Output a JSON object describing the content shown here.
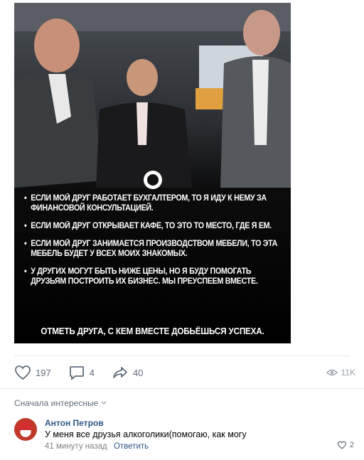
{
  "post": {
    "caption_bullets": [
      "ЕСЛИ МОЙ ДРУГ РАБОТАЕТ БУХГАЛТЕРОМ, ТО Я ИДУ К НЕМУ ЗА ФИНАНСОВОЙ КОНСУЛЬТАЦИЕЙ.",
      "ЕСЛИ МОЙ ДРУГ ОТКРЫВАЕТ КАФЕ, ТО ЭТО ТО МЕСТО, ГДЕ Я ЕМ.",
      "ЕСЛИ МОЙ ДРУГ ЗАНИМАЕТСЯ ПРОИЗВОДСТВОМ МЕБЕЛИ, ТО ЭТА МЕБЕЛЬ БУДЕТ У ВСЕХ МОИХ ЗНАКОМЫХ.",
      "У ДРУГИХ МОГУТ БЫТЬ НИЖЕ ЦЕНЫ, НО Я БУДУ ПОМОГАТЬ ДРУЗЬЯМ ПОСТРОИТЬ ИХ БИЗНЕС. МЫ ПРЕУСПЕЕМ ВМЕСТЕ."
    ],
    "cta": "ОТМЕТЬ ДРУГА, С КЕМ ВМЕСТЕ ДОБЬЁШЬСЯ УСПЕХА."
  },
  "actions": {
    "likes": "197",
    "comments": "4",
    "shares": "40",
    "views": "11K"
  },
  "comments_section": {
    "sort_label": "Сначала интересные",
    "comment": {
      "author": "Антон Петров",
      "text": "У меня все друзья алкоголики(помогаю, как могу",
      "time": "41 минуту назад",
      "reply_label": "Ответить",
      "likes": "2"
    }
  },
  "colors": {
    "link": "#2a5885",
    "icon": "#626d7a",
    "divider": "#e7e8ec"
  }
}
